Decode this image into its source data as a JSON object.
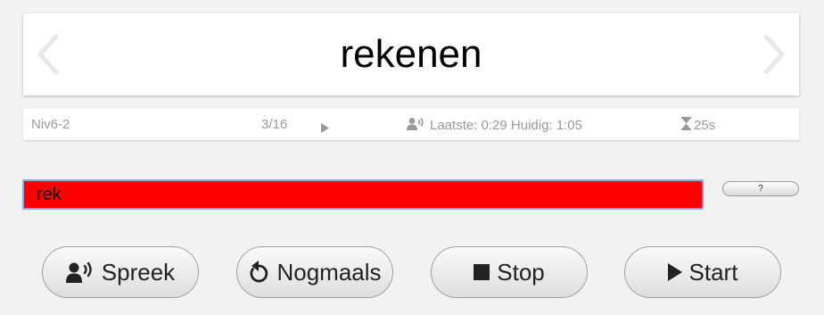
{
  "word_card": {
    "word": "rekenen",
    "prev_icon": "chevron-left-icon",
    "next_icon": "chevron-right-icon"
  },
  "info_bar": {
    "level": "Niv6-2",
    "progress": "3/16",
    "play_icon": "play-small-icon",
    "speaker_icon": "speaker-icon",
    "timing": "Laatste: 0:29 Huidig: 1:05",
    "hourglass_icon": "hourglass-icon",
    "timer": "25s"
  },
  "answer": {
    "value": "rek",
    "background": "#ff0000"
  },
  "help": {
    "label": "?"
  },
  "actions": {
    "spreek_label": "Spreek",
    "nogmaals_label": "Nogmaals",
    "stop_label": "Stop",
    "start_label": "Start"
  }
}
